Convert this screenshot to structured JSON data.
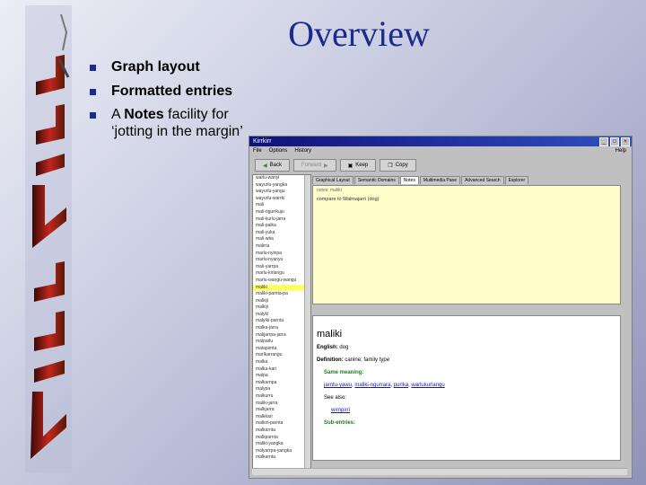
{
  "slide": {
    "title": "Overview",
    "bullets": [
      {
        "plain": "Graph layout",
        "bold_first": true
      },
      {
        "plain": "Formatted entries",
        "bold_first": true
      },
      {
        "pre": "A ",
        "bold": "Notes",
        "post": " facility for ‘jotting in the margin’"
      }
    ],
    "logo_text": "Kirrkirr",
    "colors": {
      "title": "#1c2a8c",
      "bullet": "#1a2b8c"
    }
  },
  "app": {
    "window_title": "Kirrkirr",
    "menu": [
      "File",
      "Options",
      "History"
    ],
    "menu_help": "Help",
    "toolbar": [
      {
        "label": "Back",
        "icon": "back-arrow-icon",
        "enabled": true
      },
      {
        "label": "Forward",
        "icon": "forward-arrow-icon",
        "enabled": false
      },
      {
        "label": "Keep",
        "icon": "keep-icon",
        "enabled": true
      },
      {
        "label": "Copy",
        "icon": "copy-icon",
        "enabled": true
      }
    ],
    "word_list": [
      "warlu-wanyi",
      "wayurlu-yangka",
      "wayurlu-yangu",
      "wayurlu-warrki",
      "mali",
      "mali-ngurrkuju",
      "mali-kurlu-jarra",
      "mali-palka",
      "mali-yuka",
      "mali-wita",
      "malirra",
      "marlu-nyinpa",
      "marlu-nyanyu",
      "mali-yarrpa",
      "marlu-kirlangu",
      "marlu-wangu-wangu",
      "maliki",
      "maliki-parnta-pa",
      "malkiji",
      "malkiji",
      "malyki",
      "malyiki-parnta",
      "malka-jarra",
      "malijarrpa-jarra",
      "malparlu",
      "malapirnta",
      "marlkarrangu",
      "malka",
      "malka-kari",
      "malpa",
      "malkarnpa",
      "malypa",
      "malkurru",
      "maliki-jarra",
      "malkjarra",
      "malkkari",
      "malkiri-parnta",
      "malkarnta",
      "malkparnta",
      "maliki-yangka",
      "malyarrpa-yangka",
      "malkarnta"
    ],
    "selected_index": 16,
    "tabs": [
      "Graphical Layout",
      "Semantic Domains",
      "Notes",
      "Multimedia Pane",
      "Advanced Search",
      "Explorer"
    ],
    "active_tab": 2,
    "notes": {
      "header": "notes: maliki",
      "text": "compare to Walmajarri (dog)"
    },
    "entry": {
      "headword": "maliki",
      "english_label": "English:",
      "english": "dog",
      "definition_label": "Definition:",
      "definition": "canine; family type",
      "same_meaning_label": "Same meaning:",
      "same_meaning_links": [
        "jarntu-yawu",
        "maliki-ngurrara",
        "purlka",
        "warlukurlangu"
      ],
      "see_also_label": "See also:",
      "see_also": "wirnpirri",
      "sub_entries_label": "Sub-entries:"
    }
  }
}
